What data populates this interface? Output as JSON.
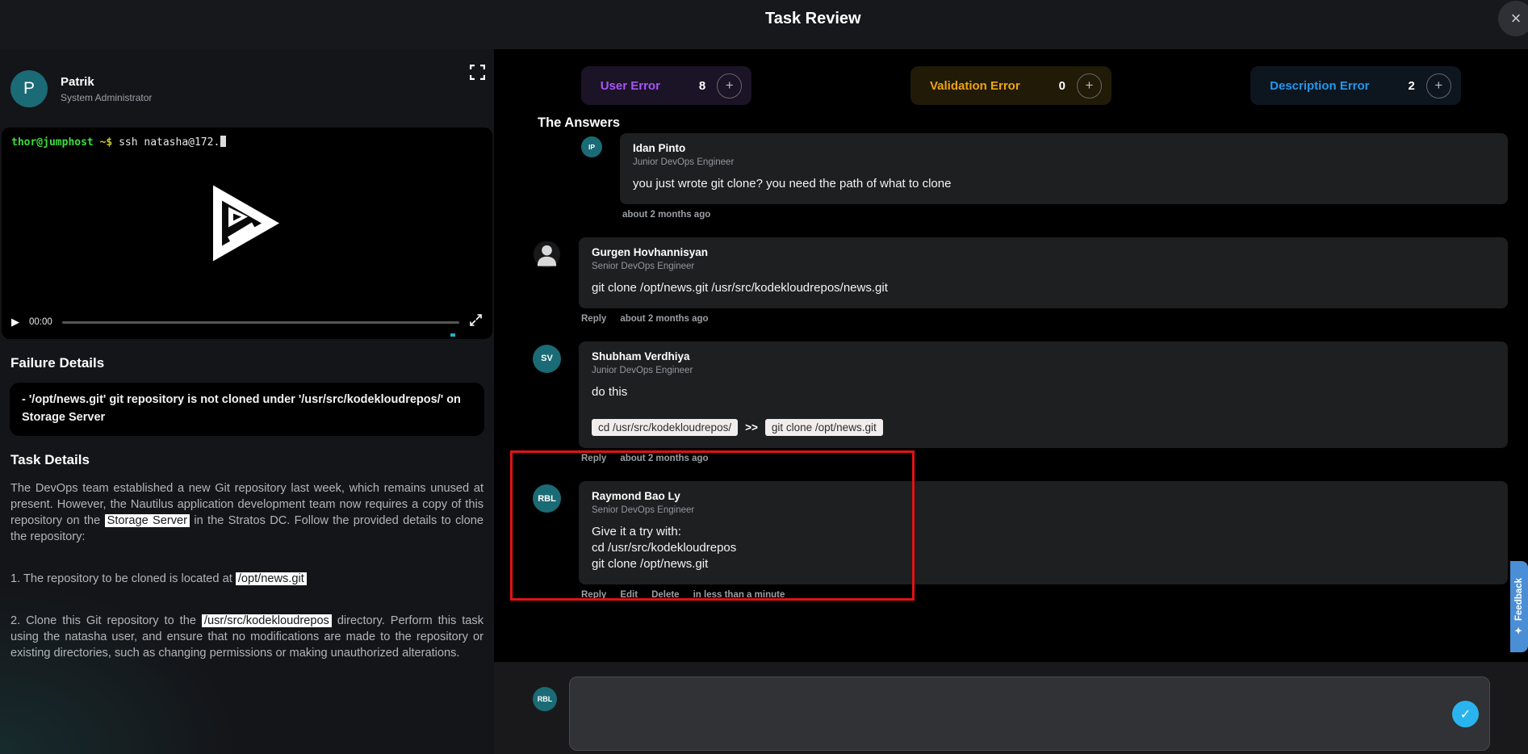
{
  "header": {
    "title": "Task Review",
    "close_icon": "×"
  },
  "profile": {
    "initial": "P",
    "name": "Patrik",
    "role": "System Administrator"
  },
  "terminal": {
    "prompt_user": "thor@jumphost",
    "prompt_symbol": " ~$ ",
    "command": "ssh natasha@172."
  },
  "player": {
    "time": "00:00",
    "play_icon": "▶"
  },
  "failure": {
    "heading": "Failure Details",
    "text": "- '/opt/news.git' git repository is not cloned under '/usr/src/kodekloudrepos/' on Storage Server"
  },
  "task": {
    "heading": "Task Details",
    "para1_before": "The DevOps team established a new Git repository last week, which remains unused at present. However, the Nautilus application development team now requires a copy of this repository on the ",
    "para1_highlight": "Storage Server",
    "para1_after": " in the Stratos DC. Follow the provided details to clone the repository:",
    "item1_before": "1. The repository to be cloned is located at ",
    "item1_highlight": "/opt/news.git",
    "item1_after": "",
    "item2_before": "2. Clone this Git repository to the ",
    "item2_highlight": "/usr/src/kodekloudrepos",
    "item2_after": " directory. Perform this task using the natasha user, and ensure that no modifications are made to the repository or existing directories, such as changing permissions or making unauthorized alterations."
  },
  "errors": [
    {
      "label": "User Error",
      "count": "8",
      "color": "#a855f7",
      "bg": "#1b1326",
      "plus_icon": "+"
    },
    {
      "label": "Validation Error",
      "count": "0",
      "color": "#eda413",
      "bg": "#211a07",
      "plus_icon": "+"
    },
    {
      "label": "Description Error",
      "count": "2",
      "color": "#2396ef",
      "bg": "#0d161f",
      "plus_icon": "+"
    }
  ],
  "answers": {
    "heading": "The Answers",
    "comments": [
      {
        "avatar": "IP",
        "avatar_type": "initials",
        "small_avatar": true,
        "indent": true,
        "name": "Idan Pinto",
        "role": "Junior DevOps Engineer",
        "message_lines": [
          "you just wrote git clone? you need the path of what to clone"
        ],
        "footer_links": [],
        "timestamp": "about 2 months ago"
      },
      {
        "avatar": "person",
        "avatar_type": "person",
        "small_avatar": false,
        "indent": false,
        "name": "Gurgen Hovhannisyan",
        "role": "Senior DevOps Engineer",
        "message_lines": [
          "git clone /opt/news.git /usr/src/kodekloudrepos/news.git"
        ],
        "footer_links": [
          "Reply"
        ],
        "timestamp": "about 2 months ago"
      },
      {
        "avatar": "SV",
        "avatar_type": "initials",
        "small_avatar": false,
        "indent": false,
        "name": "Shubham Verdhiya",
        "role": "Junior DevOps Engineer",
        "message_lines": [
          "do this"
        ],
        "chips": [
          {
            "text": "cd /usr/src/kodekloudrepos/",
            "variant": "light"
          },
          {
            "text": ">>",
            "variant": "plain"
          },
          {
            "text": "git clone /opt/news.git",
            "variant": "light"
          }
        ],
        "footer_links": [
          "Reply"
        ],
        "timestamp": "about 2 months ago"
      },
      {
        "avatar": "RBL",
        "avatar_type": "initials",
        "small_avatar": false,
        "indent": false,
        "name": "Raymond Bao Ly",
        "role": "Senior DevOps Engineer",
        "message_lines": [
          "Give it a try with:",
          "cd /usr/src/kodekloudrepos",
          "git clone /opt/news.git"
        ],
        "footer_links": [
          "Reply",
          "Edit",
          "Delete"
        ],
        "timestamp": "in less than a minute"
      }
    ]
  },
  "composer": {
    "avatar": "RBL",
    "placeholder": "",
    "send_icon": "✓"
  },
  "feedback": {
    "icon": "✦",
    "label": "Feedback"
  }
}
